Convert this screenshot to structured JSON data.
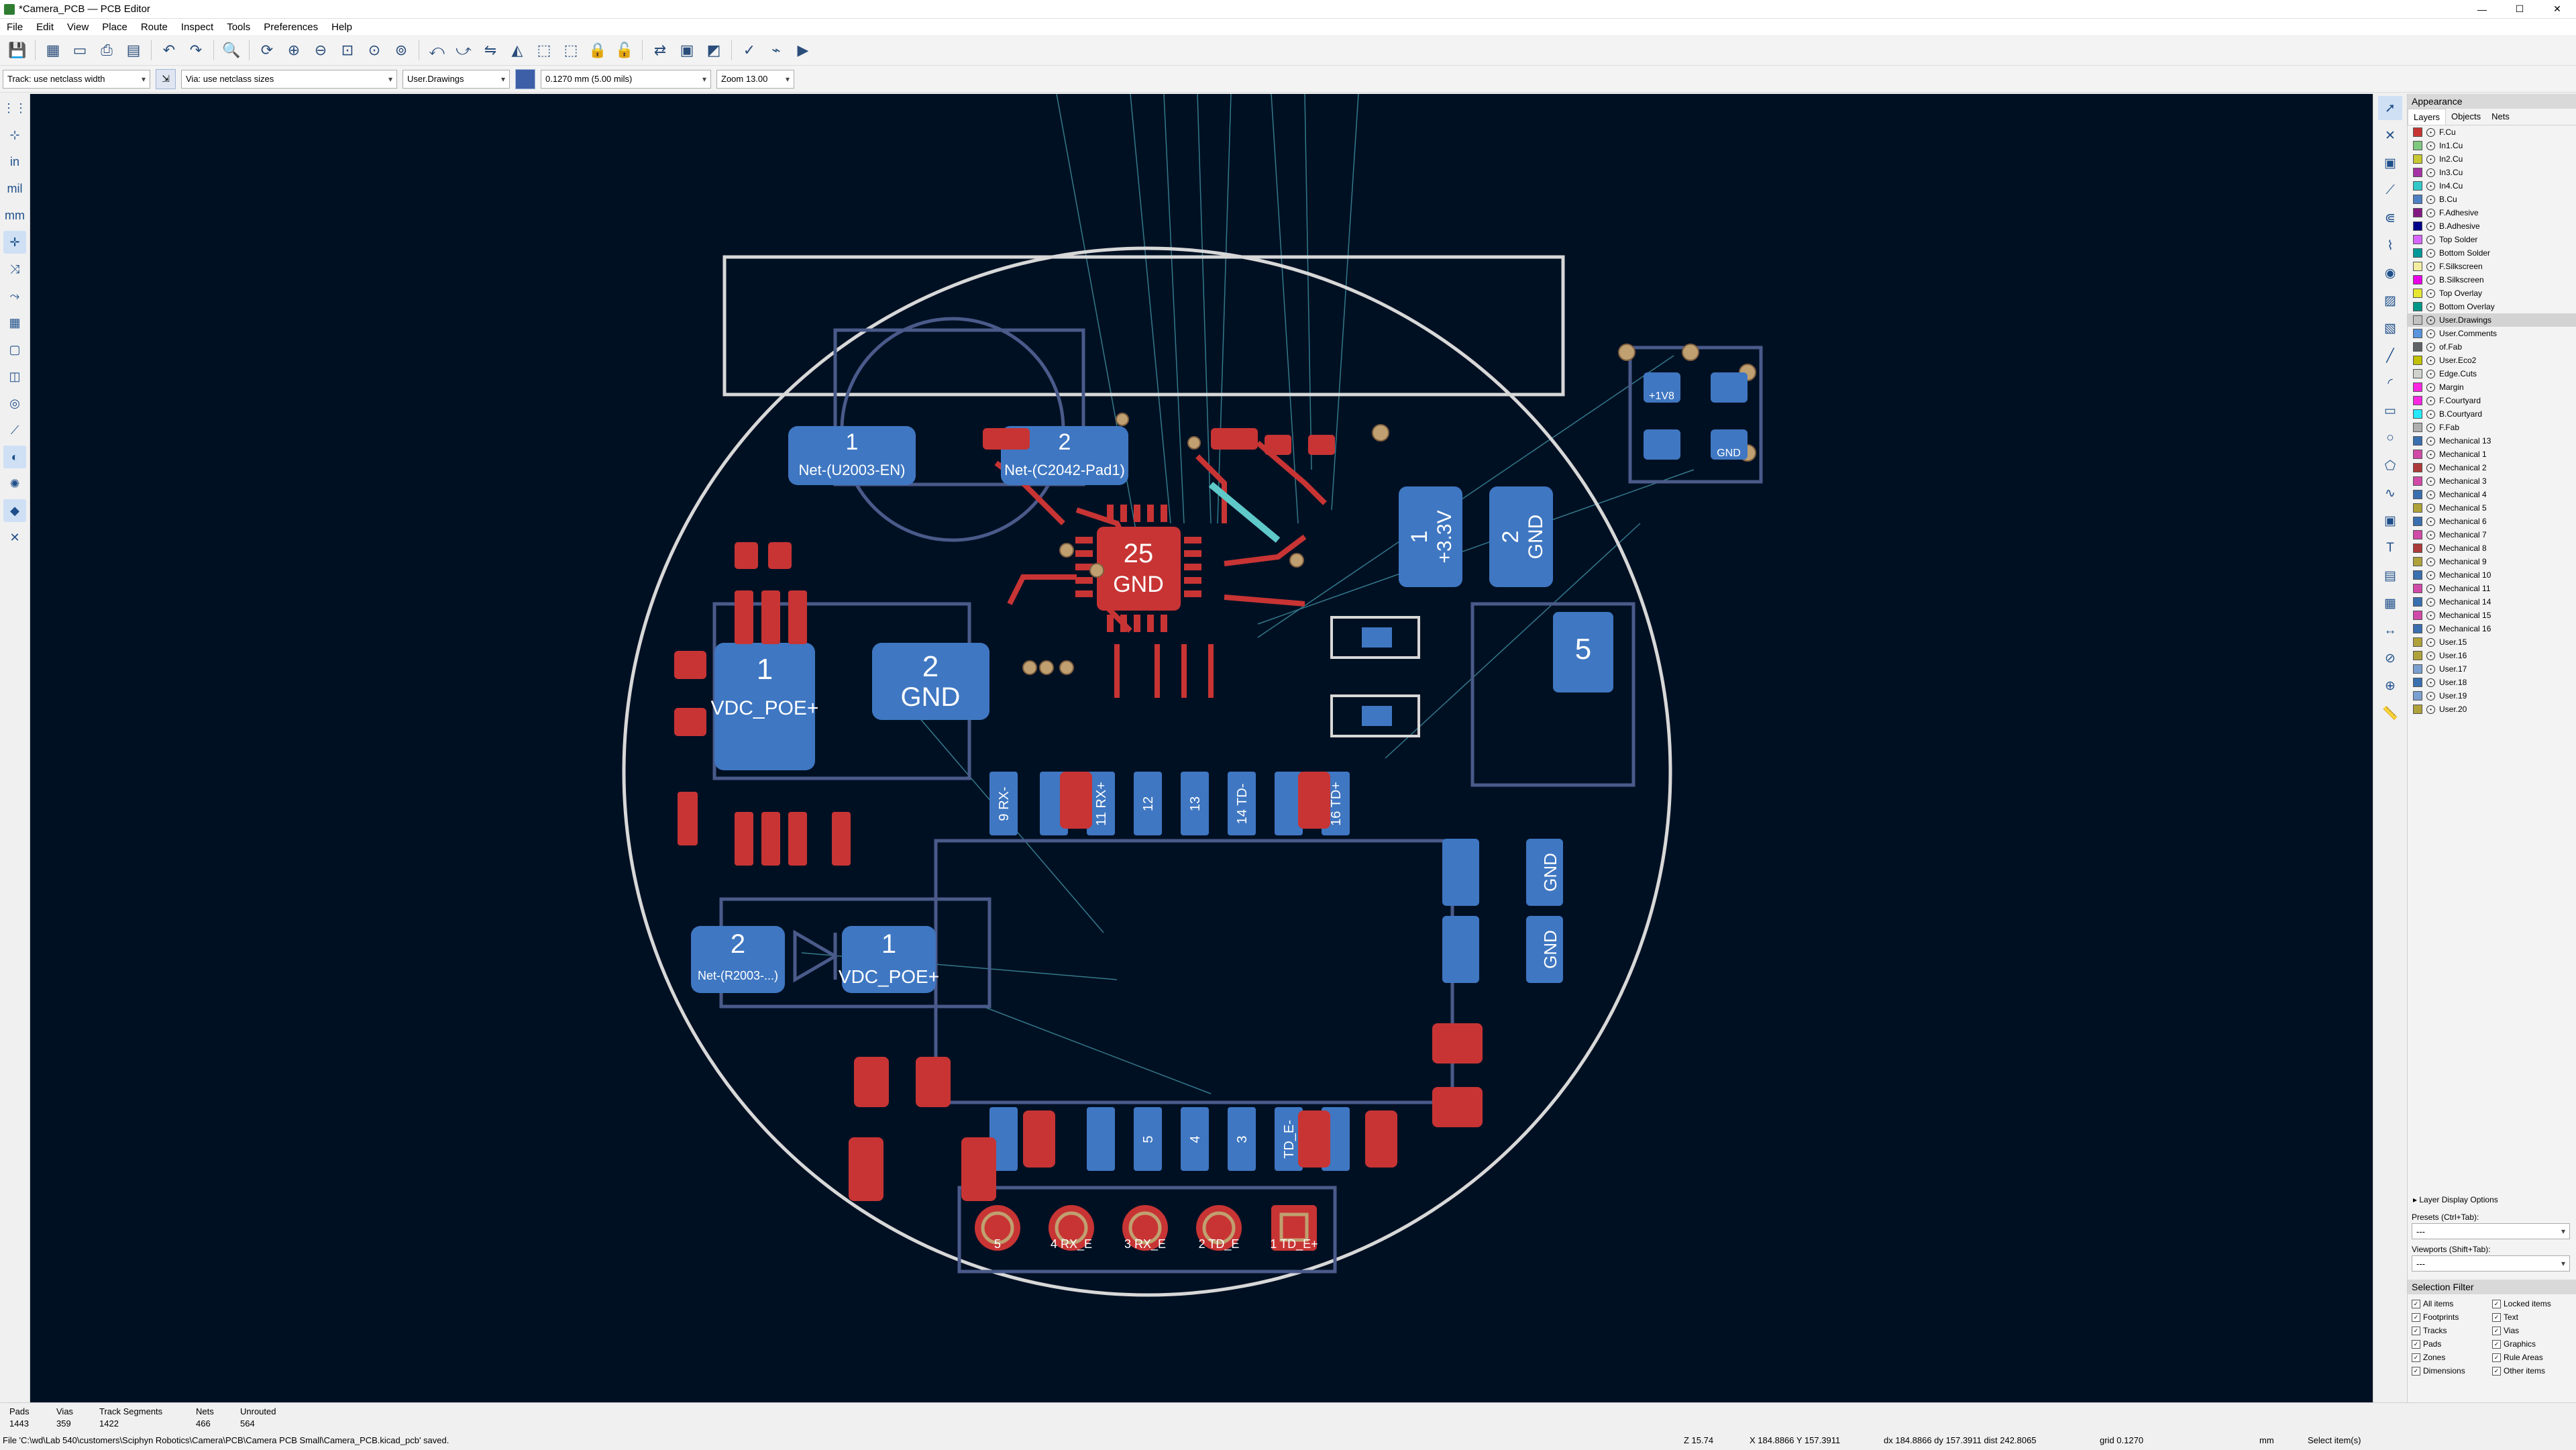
{
  "window": {
    "title": "*Camera_PCB — PCB Editor",
    "controls": [
      "—",
      "☐",
      "✕"
    ]
  },
  "menu": [
    "File",
    "Edit",
    "View",
    "Place",
    "Route",
    "Inspect",
    "Tools",
    "Preferences",
    "Help"
  ],
  "options": {
    "track": "Track: use netclass width",
    "via": "Via: use netclass sizes",
    "layer": "User.Drawings",
    "grid": "0.1270 mm (5.00 mils)",
    "zoom": "Zoom 13.00"
  },
  "left_tools": [
    {
      "icon": "grid-icon",
      "glyph": "⋮⋮"
    },
    {
      "icon": "polar-grid-icon",
      "glyph": "⊹"
    },
    {
      "icon": "inches-icon",
      "glyph": "in"
    },
    {
      "icon": "mils-icon",
      "glyph": "mil"
    },
    {
      "icon": "millimeter-icon",
      "glyph": "mm"
    },
    {
      "icon": "cursor-shape-icon",
      "glyph": "✛"
    },
    {
      "icon": "ratsnest-icon",
      "glyph": "⤨"
    },
    {
      "icon": "curved-ratsnest-icon",
      "glyph": "⤳"
    },
    {
      "icon": "zone-fill-icon",
      "glyph": "▦"
    },
    {
      "icon": "zone-outline-icon",
      "glyph": "▢"
    },
    {
      "icon": "pads-sketch-icon",
      "glyph": "◫"
    },
    {
      "icon": "vias-sketch-icon",
      "glyph": "◎"
    },
    {
      "icon": "tracks-sketch-icon",
      "glyph": "⟋"
    },
    {
      "icon": "high-contrast-icon",
      "glyph": "◐"
    },
    {
      "icon": "net-highlight-icon",
      "glyph": "✺"
    },
    {
      "icon": "appearance-panel-icon",
      "glyph": "◆"
    },
    {
      "icon": "design-rules-icon",
      "glyph": "✕"
    }
  ],
  "right_tools": [
    {
      "icon": "select-icon",
      "glyph": "➚"
    },
    {
      "icon": "local-ratsnest-icon",
      "glyph": "✕"
    },
    {
      "icon": "add-footprint-icon",
      "glyph": "▣"
    },
    {
      "icon": "route-track-icon",
      "glyph": "⟋"
    },
    {
      "icon": "diff-pair-icon",
      "glyph": "⋐"
    },
    {
      "icon": "tune-length-icon",
      "glyph": "⌇"
    },
    {
      "icon": "add-via-icon",
      "glyph": "◉"
    },
    {
      "icon": "add-zone-icon",
      "glyph": "▨"
    },
    {
      "icon": "rule-area-icon",
      "glyph": "▧"
    },
    {
      "icon": "draw-line-icon",
      "glyph": "╱"
    },
    {
      "icon": "draw-arc-icon",
      "glyph": "◜"
    },
    {
      "icon": "draw-rectangle-icon",
      "glyph": "▭"
    },
    {
      "icon": "draw-circle-icon",
      "glyph": "○"
    },
    {
      "icon": "draw-polygon-icon",
      "glyph": "⬠"
    },
    {
      "icon": "draw-bezier-icon",
      "glyph": "∿"
    },
    {
      "icon": "add-image-icon",
      "glyph": "▣"
    },
    {
      "icon": "add-text-icon",
      "glyph": "T"
    },
    {
      "icon": "add-textbox-icon",
      "glyph": "▤"
    },
    {
      "icon": "add-table-icon",
      "glyph": "▦"
    },
    {
      "icon": "add-dimension-icon",
      "glyph": "↔"
    },
    {
      "icon": "delete-tool-icon",
      "glyph": "⊘"
    },
    {
      "icon": "set-origin-icon",
      "glyph": "⊕"
    },
    {
      "icon": "measure-icon",
      "glyph": "📏"
    }
  ],
  "appearance": {
    "title": "Appearance",
    "tabs": [
      "Layers",
      "Objects",
      "Nets"
    ],
    "layers": [
      {
        "name": "F.Cu",
        "color": "#c83434"
      },
      {
        "name": "In1.Cu",
        "color": "#7fc87f"
      },
      {
        "name": "In2.Cu",
        "color": "#c8c832"
      },
      {
        "name": "In3.Cu",
        "color": "#a432a4"
      },
      {
        "name": "In4.Cu",
        "color": "#32c8c8"
      },
      {
        "name": "B.Cu",
        "color": "#4d7fc4"
      },
      {
        "name": "F.Adhesive",
        "color": "#841984"
      },
      {
        "name": "B.Adhesive",
        "color": "#00008b"
      },
      {
        "name": "Top Solder",
        "color": "#d864ff"
      },
      {
        "name": "Bottom Solder",
        "color": "#009999"
      },
      {
        "name": "F.Silkscreen",
        "color": "#f2eda1"
      },
      {
        "name": "B.Silkscreen",
        "color": "#e800e8"
      },
      {
        "name": "Top Overlay",
        "color": "#e6e632"
      },
      {
        "name": "Bottom Overlay",
        "color": "#009688"
      },
      {
        "name": "User.Drawings",
        "color": "#c2c2c2"
      },
      {
        "name": "User.Comments",
        "color": "#5994dc"
      },
      {
        "name": "of.Fab",
        "color": "#5f6266"
      },
      {
        "name": "User.Eco2",
        "color": "#c2c200"
      },
      {
        "name": "Edge.Cuts",
        "color": "#d0d2cd"
      },
      {
        "name": "Margin",
        "color": "#ff26e2"
      },
      {
        "name": "F.Courtyard",
        "color": "#ff26e2"
      },
      {
        "name": "B.Courtyard",
        "color": "#26e9ff"
      },
      {
        "name": "F.Fab",
        "color": "#afafaf"
      },
      {
        "name": "Mechanical 13",
        "color": "#3a6fb0"
      },
      {
        "name": "Mechanical 1",
        "color": "#d14aa8"
      },
      {
        "name": "Mechanical 2",
        "color": "#ad3a3a"
      },
      {
        "name": "Mechanical 3",
        "color": "#d14aa8"
      },
      {
        "name": "Mechanical 4",
        "color": "#3a6fb0"
      },
      {
        "name": "Mechanical 5",
        "color": "#b0a23a"
      },
      {
        "name": "Mechanical 6",
        "color": "#3a6fb0"
      },
      {
        "name": "Mechanical 7",
        "color": "#d14aa8"
      },
      {
        "name": "Mechanical 8",
        "color": "#ad3a3a"
      },
      {
        "name": "Mechanical 9",
        "color": "#b0a23a"
      },
      {
        "name": "Mechanical 10",
        "color": "#3a6fb0"
      },
      {
        "name": "Mechanical 11",
        "color": "#d14aa8"
      },
      {
        "name": "Mechanical 14",
        "color": "#3a6fb0"
      },
      {
        "name": "Mechanical 15",
        "color": "#d14aa8"
      },
      {
        "name": "Mechanical 16",
        "color": "#3a6fb0"
      },
      {
        "name": "User.15",
        "color": "#b0a23a"
      },
      {
        "name": "User.16",
        "color": "#b0a23a"
      },
      {
        "name": "User.17",
        "color": "#7a9fd1"
      },
      {
        "name": "User.18",
        "color": "#3a6fb0"
      },
      {
        "name": "User.19",
        "color": "#7a9fd1"
      },
      {
        "name": "User.20",
        "color": "#b0a23a"
      }
    ],
    "selected_layer": "User.Drawings",
    "layer_display_options": "Layer Display Options",
    "presets_label": "Presets (Ctrl+Tab):",
    "presets_value": "---",
    "viewports_label": "Viewports (Shift+Tab):",
    "viewports_value": "---"
  },
  "selection_filter": {
    "title": "Selection Filter",
    "items": [
      "All items",
      "Locked items",
      "Footprints",
      "Text",
      "Tracks",
      "Vias",
      "Pads",
      "Graphics",
      "Zones",
      "Rule Areas",
      "Dimensions",
      "Other items"
    ]
  },
  "pcb": {
    "pads": [
      {
        "num": "1",
        "net": "Net-(U2003-EN)"
      },
      {
        "num": "2",
        "net": "Net-(C2042-Pad1)"
      },
      {
        "num": "25",
        "net": "GND"
      },
      {
        "num": "1",
        "net": "VDC_POE+"
      },
      {
        "num": "2",
        "net": "GND"
      },
      {
        "num": "1",
        "net": "+3.3V"
      },
      {
        "num": "2",
        "net": "GND"
      },
      {
        "num": "2",
        "net": "Net-(R2003-...)"
      },
      {
        "num": "1",
        "net": "VDC_POE+"
      },
      {
        "num": "5",
        "net": ""
      }
    ],
    "header_pads": [
      "9 RX-",
      "11 RX+",
      "12",
      "13",
      "14 TD-",
      "16 TD+"
    ],
    "bottom_pads": [
      "5",
      "4",
      "3",
      "TD_E-"
    ],
    "connector": [
      "5",
      "4 RX_E",
      "3 RX_E",
      "2 TD_E",
      "1 TD_E+"
    ],
    "reg_pads": [
      "+1V8",
      "GND"
    ],
    "side_pads": [
      "GND",
      "GND"
    ]
  },
  "status": {
    "pads_label": "Pads",
    "pads": "1443",
    "vias_label": "Vias",
    "vias": "359",
    "tracks_label": "Track Segments",
    "tracks": "1422",
    "nets_label": "Nets",
    "nets": "466",
    "unrouted_label": "Unrouted",
    "unrouted": "564",
    "file_msg": "File 'C:\\wd\\Lab 540\\customers\\Sciphyn Robotics\\Camera\\PCB\\Camera PCB Small\\Camera_PCB.kicad_pcb' saved.",
    "zoom": "Z 15.74",
    "xy": "X 184.8866  Y 157.3911",
    "delta": "dx 184.8866  dy 157.3911  dist 242.8065",
    "grid": "grid 0.1270",
    "units": "mm",
    "mode": "Select item(s)"
  }
}
